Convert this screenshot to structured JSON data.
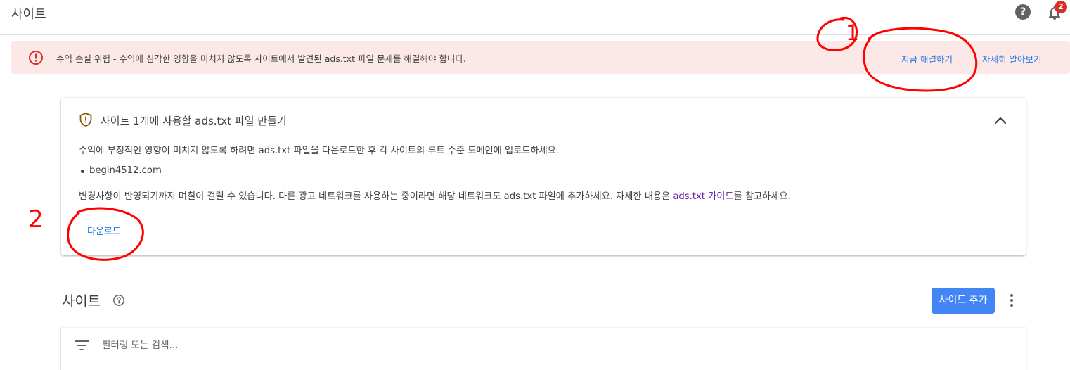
{
  "header": {
    "title": "사이트",
    "help_label": "?",
    "notification_count": "2"
  },
  "alert": {
    "message": "수익 손실 위험 - 수익에 심각한 영향을 미치지 않도록 사이트에서 발견된 ads.txt 파일 문제를 해결해야 합니다.",
    "fix_now_label": "지금 해결하기",
    "learn_more_label": "자세히 알아보기"
  },
  "card": {
    "title": "사이트 1개에 사용할 ads.txt 파일 만들기",
    "description": "수익에 부정적인 영향이 미치지 않도록 하려면 ads.txt 파일을 다운로드한 후 각 사이트의 루트 수준 도메인에 업로드하세요.",
    "sites": [
      "begin4512.com"
    ],
    "note_before_link": "변경사항이 반영되기까지 며칠이 걸릴 수 있습니다. 다른 광고 네트워크를 사용하는 중이라면 해당 네트워크도 ads.txt 파일에 추가하세요. 자세한 내용은 ",
    "guide_link_label": "ads.txt 가이드",
    "note_after_link": "를 참고하세요.",
    "download_label": "다운로드"
  },
  "sites_section": {
    "title": "사이트",
    "add_site_label": "사이트 추가",
    "filter_placeholder": "필터링 또는 검색..."
  },
  "annotations": {
    "mark_1": "1",
    "mark_2": "2",
    "color": "#ff0000"
  },
  "colors": {
    "alert_bg": "#fce8e6",
    "alert_icon": "#d93025",
    "link": "#1a73e8",
    "primary_button": "#4285f4",
    "shield_icon": "#8a5a00"
  }
}
